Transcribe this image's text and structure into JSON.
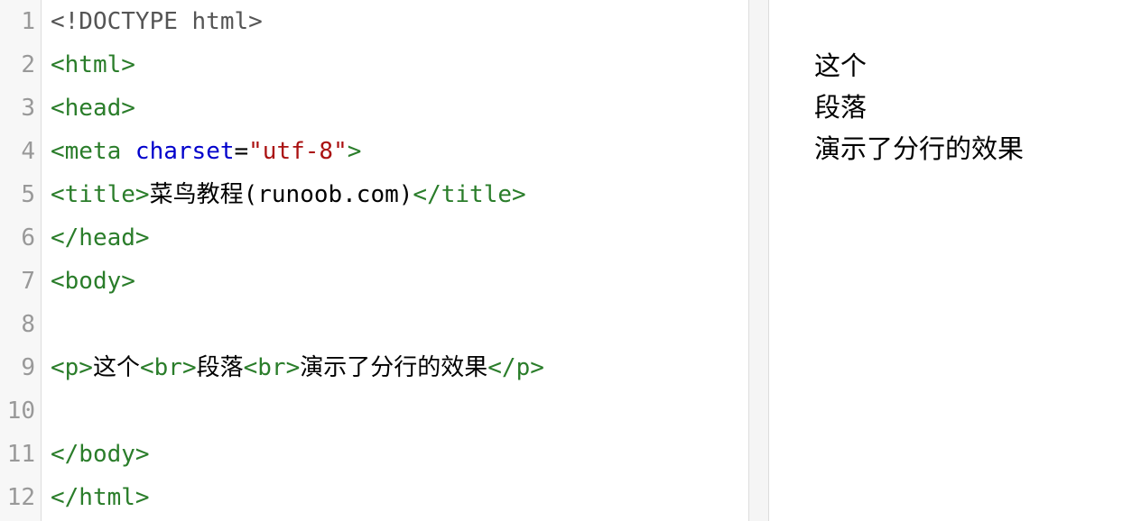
{
  "editor": {
    "line_numbers": [
      "1",
      "2",
      "3",
      "4",
      "5",
      "6",
      "7",
      "8",
      "9",
      "10",
      "11",
      "12"
    ],
    "lines": {
      "l1": "<!DOCTYPE html>",
      "l2": "<html>",
      "l3": "<head>",
      "l4_open": "<meta ",
      "l4_attr": "charset",
      "l4_eq": "=",
      "l4_val": "\"utf-8\"",
      "l4_close": ">",
      "l5_open": "<title>",
      "l5_text": "菜鸟教程(runoob.com)",
      "l5_close": "</title>",
      "l6": "</head>",
      "l7": "<body>",
      "l8": "",
      "l9_p_open": "<p>",
      "l9_t1": "这个",
      "l9_br1": "<br>",
      "l9_t2": "段落",
      "l9_br2": "<br>",
      "l9_t3": "演示了分行的效果",
      "l9_p_close": "</p>",
      "l10": "",
      "l11": "</body>",
      "l12": "</html>"
    }
  },
  "preview": {
    "lines": [
      "这个",
      "段落",
      "演示了分行的效果"
    ]
  },
  "colors": {
    "tag": "#2a7d2a",
    "attribute": "#0000cc",
    "string": "#aa1111",
    "doctype": "#555555",
    "gutter_bg": "#f7f7f7",
    "line_number": "#999999"
  }
}
